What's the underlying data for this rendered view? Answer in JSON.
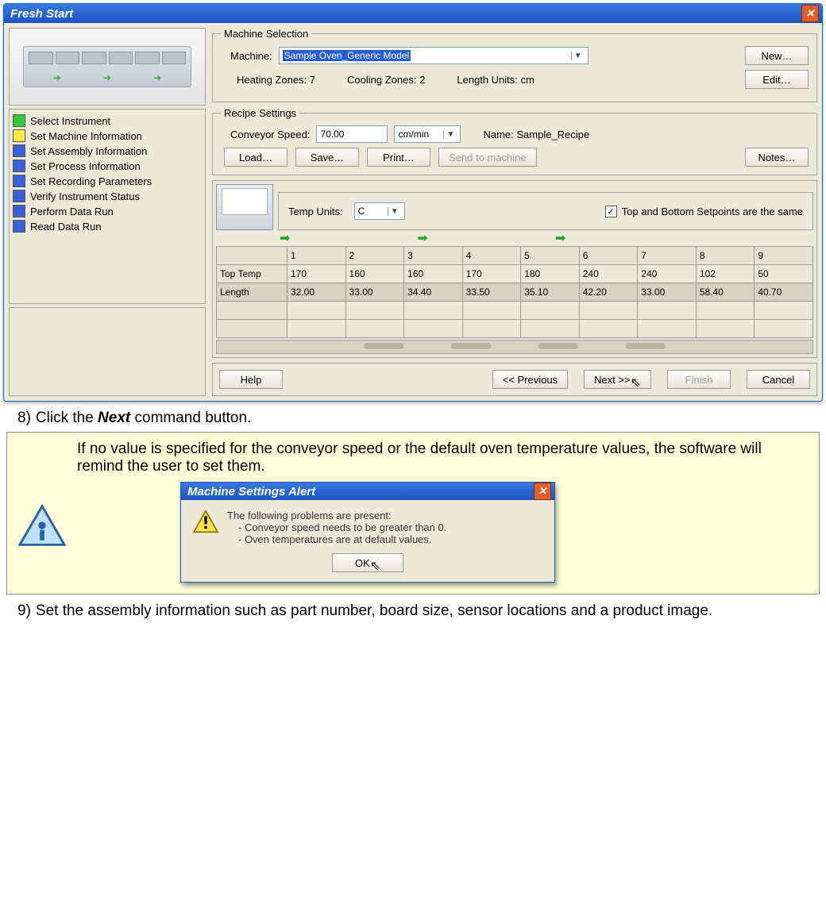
{
  "freshStart": {
    "title": "Fresh Start",
    "steps": [
      {
        "color": "green",
        "label": "Select Instrument"
      },
      {
        "color": "yellow",
        "label": "Set Machine Information"
      },
      {
        "color": "blue",
        "label": "Set Assembly Information"
      },
      {
        "color": "blue",
        "label": "Set Process Information"
      },
      {
        "color": "blue",
        "label": "Set Recording Parameters"
      },
      {
        "color": "blue",
        "label": "Verify Instrument Status"
      },
      {
        "color": "blue",
        "label": "Perform Data Run"
      },
      {
        "color": "blue",
        "label": "Read Data Run"
      }
    ],
    "machineSelection": {
      "legend": "Machine Selection",
      "machineLabel": "Machine:",
      "machineValue": "Sample Oven_Generic Model",
      "newBtn": "New…",
      "editBtn": "Edit…",
      "heatingZonesLabel": "Heating Zones: 7",
      "coolingZonesLabel": "Cooling Zones: 2",
      "lengthUnitsLabel": "Length Units: cm"
    },
    "recipe": {
      "legend": "Recipe Settings",
      "conveyorLabel": "Conveyor Speed:",
      "conveyorValue": "70.00",
      "conveyorUnit": "cm/min",
      "nameLabel": "Name: Sample_Recipe",
      "loadBtn": "Load…",
      "saveBtn": "Save…",
      "printBtn": "Print…",
      "sendBtn": "Send to machine",
      "notesBtn": "Notes…"
    },
    "zones": {
      "tempUnitsLabel": "Temp Units:",
      "tempUnit": "C",
      "sameLabel": "Top and Bottom Setpoints are the same",
      "headers": [
        "1",
        "2",
        "3",
        "4",
        "5",
        "6",
        "7",
        "8",
        "9"
      ],
      "rows": [
        {
          "name": "Top Temp",
          "vals": [
            "170",
            "160",
            "160",
            "170",
            "180",
            "240",
            "240",
            "102",
            "50"
          ]
        },
        {
          "name": "Length",
          "vals": [
            "32.00",
            "33.00",
            "34.40",
            "33.50",
            "35.10",
            "42.20",
            "33.00",
            "58.40",
            "40.70"
          ]
        }
      ]
    },
    "nav": {
      "help": "Help",
      "prev": "<< Previous",
      "next": "Next >>",
      "finish": "Finish",
      "cancel": "Cancel"
    }
  },
  "instr8": "Click the Next command button.",
  "note": {
    "text": "If no value is specified for the conveyor speed or the default oven temperature values, the software will remind the user to set them.",
    "alertTitle": "Machine Settings Alert",
    "alertHeading": "The following problems are present:",
    "alertLine1": "- Conveyor speed needs to be greater than 0.",
    "alertLine2": "- Oven temperatures are at default values.",
    "okBtn": "OK"
  },
  "instr9": "Set the assembly information such as part number, board size, sensor locations and a product image."
}
